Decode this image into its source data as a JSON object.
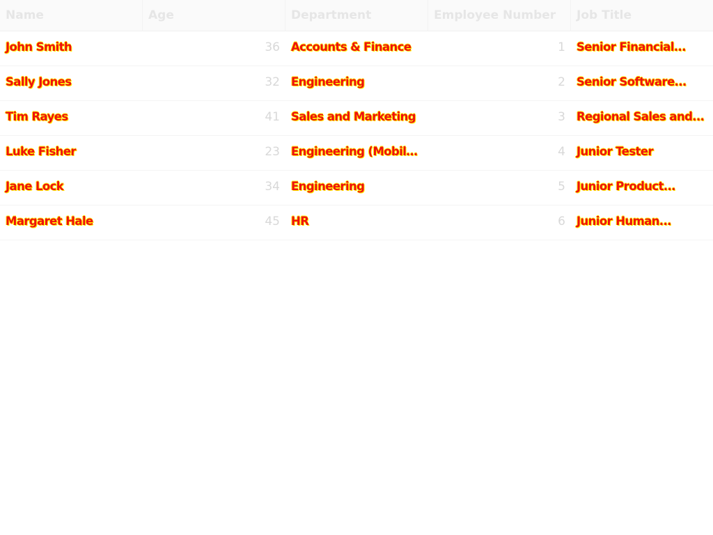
{
  "table": {
    "columns": [
      "Name",
      "Age",
      "Department",
      "Employee Number",
      "Job Title"
    ],
    "rows": [
      {
        "name": "John Smith",
        "age": "36",
        "department": "Accounts & Finance",
        "employee_number": "1",
        "job_title": "Senior Financial..."
      },
      {
        "name": "Sally Jones",
        "age": "32",
        "department": "Engineering",
        "employee_number": "2",
        "job_title": "Senior Software..."
      },
      {
        "name": "Tim Rayes",
        "age": "41",
        "department": "Sales and Marketing",
        "employee_number": "3",
        "job_title": "Regional Sales and..."
      },
      {
        "name": "Luke Fisher",
        "age": "23",
        "department": "Engineering (Mobile...",
        "employee_number": "4",
        "job_title": "Junior Tester"
      },
      {
        "name": "Jane Lock",
        "age": "34",
        "department": "Engineering",
        "employee_number": "5",
        "job_title": "Junior Product..."
      },
      {
        "name": "Margaret Hale",
        "age": "45",
        "department": "HR",
        "employee_number": "6",
        "job_title": "Junior Human..."
      }
    ]
  },
  "colors": {
    "cell_text": "#ee1010",
    "cell_text_outline": "#ffee00",
    "header_text": "#e6e6e6",
    "number_text": "#d8d8d8"
  }
}
